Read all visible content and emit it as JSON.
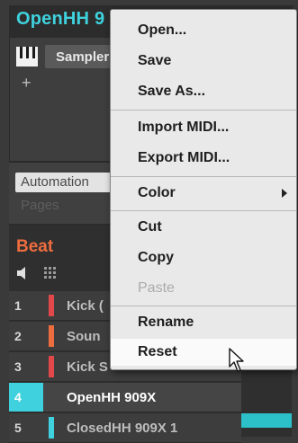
{
  "sound_slot": {
    "name": "OpenHH 9",
    "tab_label": "Sampler",
    "add_symbol": "+"
  },
  "control_area": {
    "automation_label": "Automation",
    "pages_label": "Pages"
  },
  "group": {
    "name": "Beat"
  },
  "sounds": [
    {
      "num": "1",
      "name": "Kick (",
      "color": "#e2474a"
    },
    {
      "num": "2",
      "name": "Soun",
      "color": "#ee6d3f"
    },
    {
      "num": "3",
      "name": "Kick S",
      "color": "#e2474a"
    },
    {
      "num": "4",
      "name": "OpenHH 909X",
      "color": "#3fd2de"
    },
    {
      "num": "5",
      "name": "ClosedHH 909X 1",
      "color": "#3fd2de"
    }
  ],
  "context_menu": {
    "items": [
      {
        "label": "Open...",
        "enabled": true
      },
      {
        "label": "Save",
        "enabled": true
      },
      {
        "label": "Save As...",
        "enabled": true
      },
      {
        "label": "Import MIDI...",
        "enabled": true
      },
      {
        "label": "Export MIDI...",
        "enabled": true
      },
      {
        "label": "Color",
        "enabled": true,
        "submenu": true
      },
      {
        "label": "Cut",
        "enabled": true
      },
      {
        "label": "Copy",
        "enabled": true
      },
      {
        "label": "Paste",
        "enabled": false
      },
      {
        "label": "Rename",
        "enabled": true
      },
      {
        "label": "Reset",
        "enabled": true,
        "hovered": true
      }
    ]
  },
  "colors": {
    "accent_cyan": "#3fd2de",
    "group_orange": "#ee6d3f",
    "kick_red": "#e2474a"
  }
}
